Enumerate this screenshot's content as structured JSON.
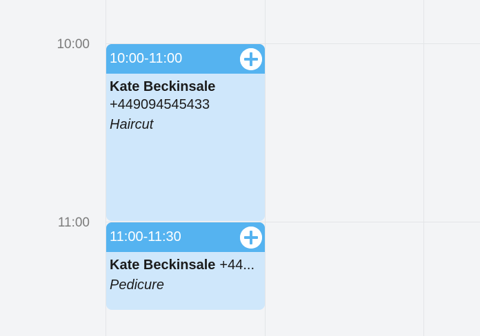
{
  "time_labels": [
    "10:00",
    "11:00"
  ],
  "events": [
    {
      "time": "10:00-11:00",
      "client_name": "Kate Beckinsale",
      "phone": "+449094545433",
      "service": "Haircut"
    },
    {
      "time": "11:00-11:30",
      "client_name": "Kate Beckinsale",
      "phone": "+44...",
      "service": "Pedicure"
    }
  ],
  "colors": {
    "event_header": "#55b3f0",
    "event_body": "#cfe7fb",
    "background": "#f3f4f6"
  },
  "icons": {
    "add": "plus-circle-icon"
  }
}
